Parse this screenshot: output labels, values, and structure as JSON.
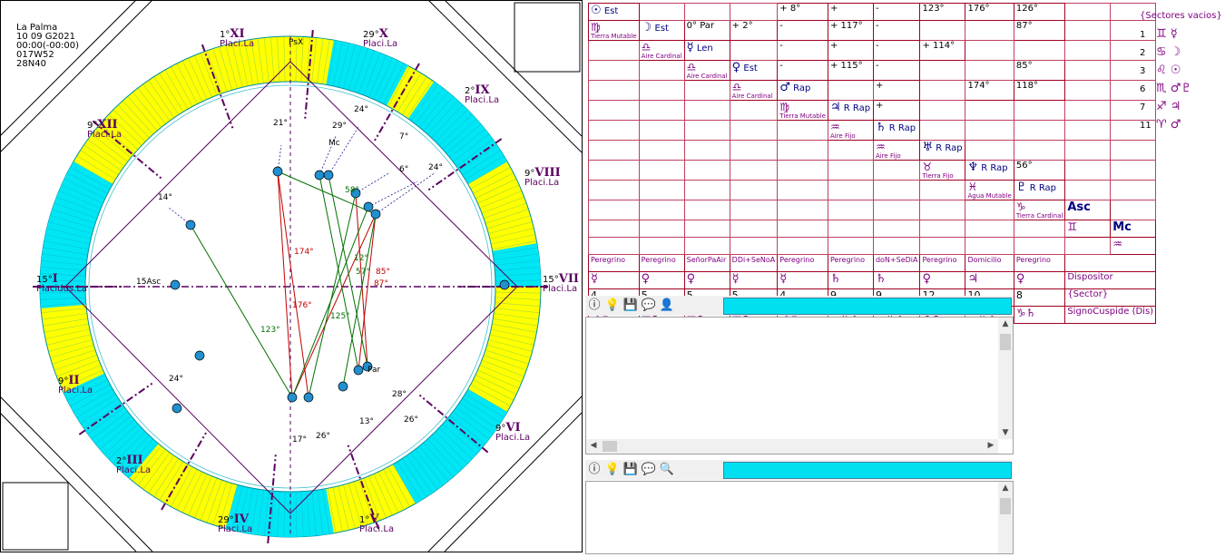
{
  "chart_header": {
    "place": "La Palma",
    "date": "10 09 G2021",
    "time": "00:00(-00:00)",
    "longitude": "017W52",
    "latitude": "28N40"
  },
  "houses": [
    {
      "roman": "I",
      "deg": "15°",
      "sys": "Placidus.La"
    },
    {
      "roman": "II",
      "deg": "9°",
      "sys": "Placi.La"
    },
    {
      "roman": "III",
      "deg": "2°",
      "sys": "Placi.La"
    },
    {
      "roman": "IV",
      "deg": "29°",
      "sys": "Placi.La"
    },
    {
      "roman": "V",
      "deg": "1°",
      "sys": "Placi.La"
    },
    {
      "roman": "VI",
      "deg": "9°",
      "sys": "Placi.La"
    },
    {
      "roman": "VII",
      "deg": "15°",
      "sys": "Placi.La"
    },
    {
      "roman": "VIII",
      "deg": "9°",
      "sys": "Placi.La"
    },
    {
      "roman": "IX",
      "deg": "2°",
      "sys": "Placi.La"
    },
    {
      "roman": "X",
      "deg": "29°",
      "sys": "Placi.La"
    },
    {
      "roman": "XI",
      "deg": "1°",
      "sys": "Placi.La"
    },
    {
      "roman": "XII",
      "deg": "9°",
      "sys": "Placi.La"
    }
  ],
  "wheel_labels": {
    "psx": "PsX",
    "asc_label": "15Asc",
    "mc": "Mc",
    "par": "Par",
    "deg_21": "21°",
    "deg_24a": "24°",
    "deg_29": "29°",
    "deg_7": "7°",
    "deg_6": "6°",
    "deg_24b": "24°",
    "deg_14": "14°",
    "deg_24c": "24°",
    "deg_17": "17°",
    "deg_26a": "26°",
    "deg_13": "13°",
    "deg_28": "28°",
    "deg_26b": "26°",
    "deg_58": "58°",
    "deg_123": "123°",
    "deg_174": "174°",
    "deg_176": "176°",
    "deg_125": "125°",
    "deg_85": "85°",
    "deg_87": "87°",
    "deg_57": "57°",
    "deg_12": "12°"
  },
  "grid": {
    "row0": {
      "planet": "☉",
      "status": "Est",
      "a1": "+ 8°",
      "a2": "+",
      "a3": "-",
      "a4": "123°",
      "a5": "176°",
      "a6": "126°"
    },
    "row1": {
      "sign": "♍",
      "elem": "Tierra",
      "mode": "Mutable",
      "planet": "☽",
      "status": "Est",
      "a1": "0° Par",
      "a2": "+ 2°",
      "a3": "-",
      "a4": "+ 117°",
      "a5": "-",
      "a6": "87°"
    },
    "row2": {
      "sign": "♎",
      "elem": "Aire",
      "mode": "Cardinal",
      "planet": "☿",
      "status": "Len",
      "a1": "-",
      "a2": "+",
      "a3": "-",
      "a4": "+ 114°"
    },
    "row3": {
      "sign": "♎",
      "elem": "Aire",
      "mode": "Cardinal",
      "planet": "♀",
      "status": "Est",
      "a1": "-",
      "a2": "+ 115°",
      "a3": "-",
      "a4": "85°"
    },
    "row4": {
      "sign": "♎",
      "elem": "Aire",
      "mode": "Cardinal",
      "planet": "♂",
      "status": "Rap",
      "a1": "+",
      "a2": "174°",
      "a3": "118°"
    },
    "row5": {
      "sign": "♍",
      "elem": "Tierra",
      "mode": "Mutable",
      "planet": "♃",
      "status": "R Rap",
      "a1": "+"
    },
    "row6": {
      "sign": "♒",
      "elem": "Aire",
      "mode": "Fijo",
      "planet": "♄",
      "status": "R Rap"
    },
    "row7": {
      "sign": "♒",
      "elem": "Aire",
      "mode": "Fijo",
      "planet": "♅",
      "status": "R Rap"
    },
    "row8": {
      "sign": "♉",
      "elem": "Tierra",
      "mode": "Fijo",
      "planet": "♆",
      "status": "R Rap",
      "a1": "56°"
    },
    "row9": {
      "sign": "♓",
      "elem": "Agua",
      "mode": "Mutable",
      "planet": "♇",
      "status": "R Rap"
    },
    "row10": {
      "sign": "♑",
      "elem": "Tierra",
      "mode": "Cardinal",
      "planet": "Asc"
    },
    "row11": {
      "sign": "♊",
      "planet": "Mc",
      "sign2": "♒"
    },
    "dignity": [
      "Peregrino",
      "Peregrino",
      "SeñorPaAir",
      "DDi+SeNoA",
      "Peregrino",
      "Peregrino",
      "doN+SeDiA",
      "Peregrino",
      "Domicilio",
      "Peregrino"
    ],
    "dispositor": [
      "☿",
      "♀",
      "♀",
      "☿",
      "☿",
      "♄",
      "♄",
      "♀",
      "♃",
      "♀"
    ],
    "dispositor_label": "Dispositor",
    "sector": [
      "4",
      "5",
      "5",
      "5",
      "4",
      "9",
      "9",
      "12",
      "10",
      "8"
    ],
    "sector_label": "{Sector}",
    "cusp": [
      "♌☉",
      "♎♀",
      "♎♀",
      "♎♀",
      "♌☉",
      "♒♄♅",
      "♒♄♅",
      "♉♀",
      "♒♄♅",
      "♑♄"
    ],
    "cusp_label": "SignoCuspide (Dis)"
  },
  "vacios": {
    "title": "{Sectores vacios}",
    "items": [
      {
        "n": "1",
        "g": "♊ ☿"
      },
      {
        "n": "2",
        "g": "♋ ☽"
      },
      {
        "n": "3",
        "g": "♌ ☉"
      },
      {
        "n": "6",
        "g": "♏ ♂♇"
      },
      {
        "n": "7",
        "g": "♐ ♃"
      },
      {
        "n": "11",
        "g": "♈ ♂"
      }
    ]
  },
  "colors": {
    "yellow": "#ffff00",
    "cyan": "#00e6f5",
    "aspect_red": "#c00000",
    "aspect_green": "#007000",
    "cusp_line": "#5a0060"
  }
}
